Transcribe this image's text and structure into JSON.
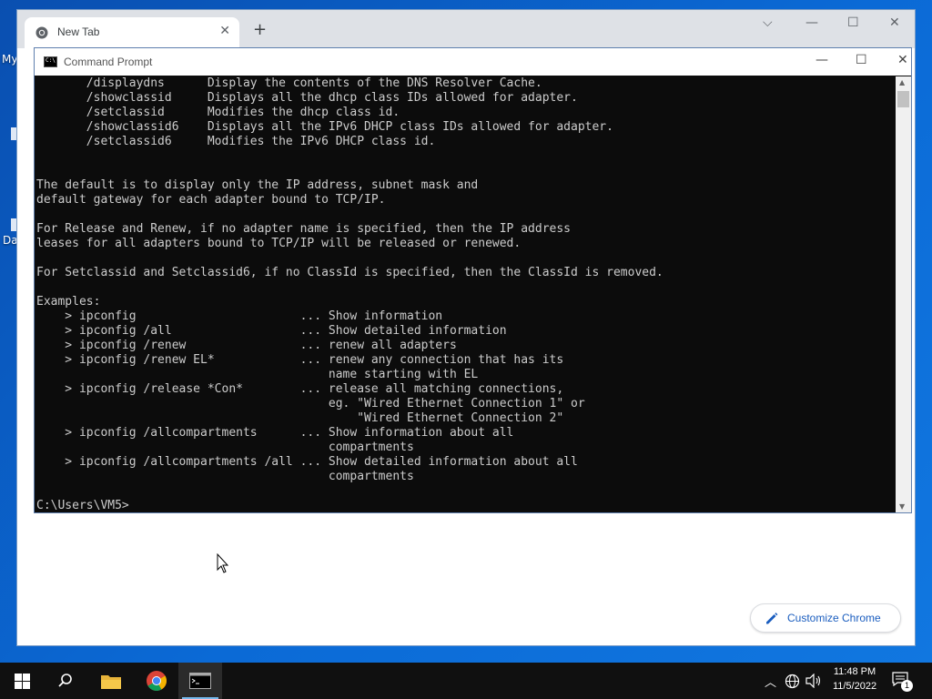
{
  "desktop": {
    "label_my": "My",
    "label_da": "Da"
  },
  "chrome": {
    "tab_title": "New Tab",
    "new_tab_symbol": "+",
    "customize_label": "Customize Chrome"
  },
  "cmd": {
    "title": "Command Prompt",
    "lines": [
      "       /displaydns      Display the contents of the DNS Resolver Cache.",
      "       /showclassid     Displays all the dhcp class IDs allowed for adapter.",
      "       /setclassid      Modifies the dhcp class id.",
      "       /showclassid6    Displays all the IPv6 DHCP class IDs allowed for adapter.",
      "       /setclassid6     Modifies the IPv6 DHCP class id.",
      "",
      "",
      "The default is to display only the IP address, subnet mask and",
      "default gateway for each adapter bound to TCP/IP.",
      "",
      "For Release and Renew, if no adapter name is specified, then the IP address",
      "leases for all adapters bound to TCP/IP will be released or renewed.",
      "",
      "For Setclassid and Setclassid6, if no ClassId is specified, then the ClassId is removed.",
      "",
      "Examples:",
      "    > ipconfig                       ... Show information",
      "    > ipconfig /all                  ... Show detailed information",
      "    > ipconfig /renew                ... renew all adapters",
      "    > ipconfig /renew EL*            ... renew any connection that has its",
      "                                         name starting with EL",
      "    > ipconfig /release *Con*        ... release all matching connections,",
      "                                         eg. \"Wired Ethernet Connection 1\" or",
      "                                             \"Wired Ethernet Connection 2\"",
      "    > ipconfig /allcompartments      ... Show information about all",
      "                                         compartments",
      "    > ipconfig /allcompartments /all ... Show detailed information about all",
      "                                         compartments",
      "",
      "C:\\Users\\VM5>"
    ]
  },
  "taskbar": {
    "time": "11:48 PM",
    "date": "11/5/2022",
    "notification_count": "1"
  }
}
